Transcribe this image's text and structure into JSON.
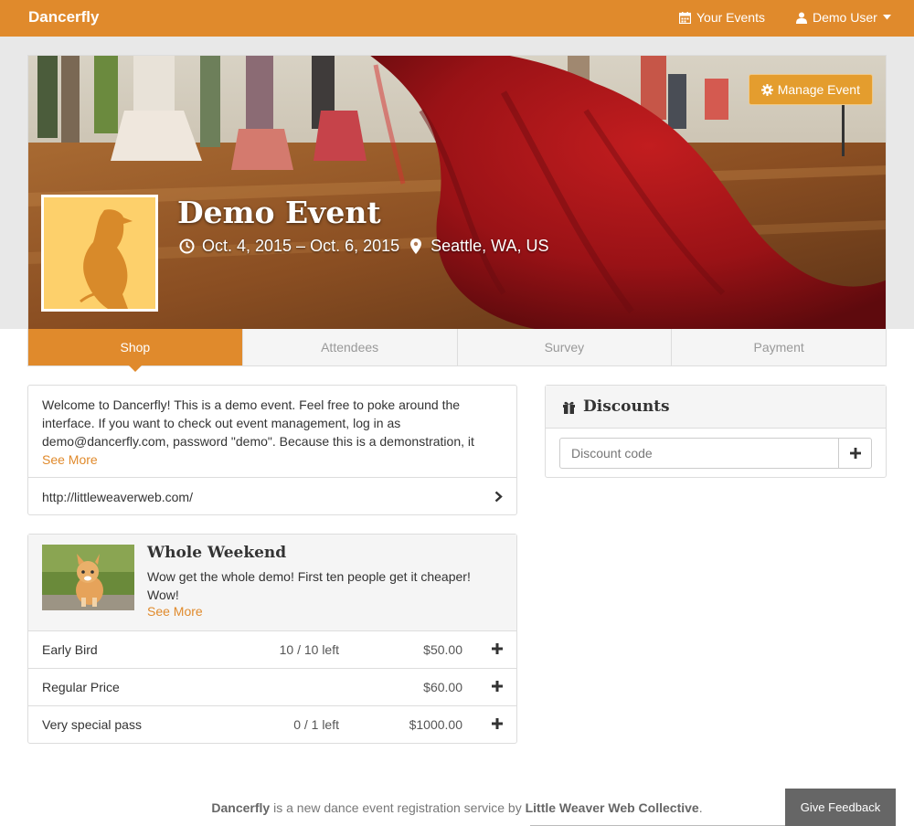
{
  "navbar": {
    "brand": "Dancerfly",
    "your_events": "Your Events",
    "user": "Demo User"
  },
  "event": {
    "title": "Demo Event",
    "dates": "Oct. 4, 2015 – Oct. 6, 2015",
    "location": "Seattle, WA, US",
    "manage_label": "Manage Event"
  },
  "tabs": [
    {
      "label": "Shop",
      "active": true
    },
    {
      "label": "Attendees"
    },
    {
      "label": "Survey"
    },
    {
      "label": "Payment"
    }
  ],
  "description": {
    "text": "Welcome to Dancerfly! This is a demo event. Feel free to poke around the interface. If you want to check out event management, log in as demo@dancerfly.com, password \"demo\". Because this is a demonstration, it",
    "see_more": "See More",
    "link": "http://littleweaverweb.com/"
  },
  "ticket_group": {
    "title": "Whole Weekend",
    "description": "Wow get the whole demo! First ten people get it cheaper! Wow!",
    "see_more": "See More",
    "items": [
      {
        "name": "Early Bird",
        "left": "10 / 10 left",
        "price": "$50.00"
      },
      {
        "name": "Regular Price",
        "left": "",
        "price": "$60.00"
      },
      {
        "name": "Very special pass",
        "left": "0 / 1 left",
        "price": "$1000.00"
      }
    ]
  },
  "discounts": {
    "title": "Discounts",
    "placeholder": "Discount code"
  },
  "footer": {
    "brand": "Dancerfly",
    "middle": " is a new dance event registration service by ",
    "org": "Little Weaver Web Collective",
    "end": ".",
    "feedback": "Give Feedback"
  },
  "colors": {
    "accent": "#e08a2c",
    "hero_dress": "#a4141a"
  }
}
